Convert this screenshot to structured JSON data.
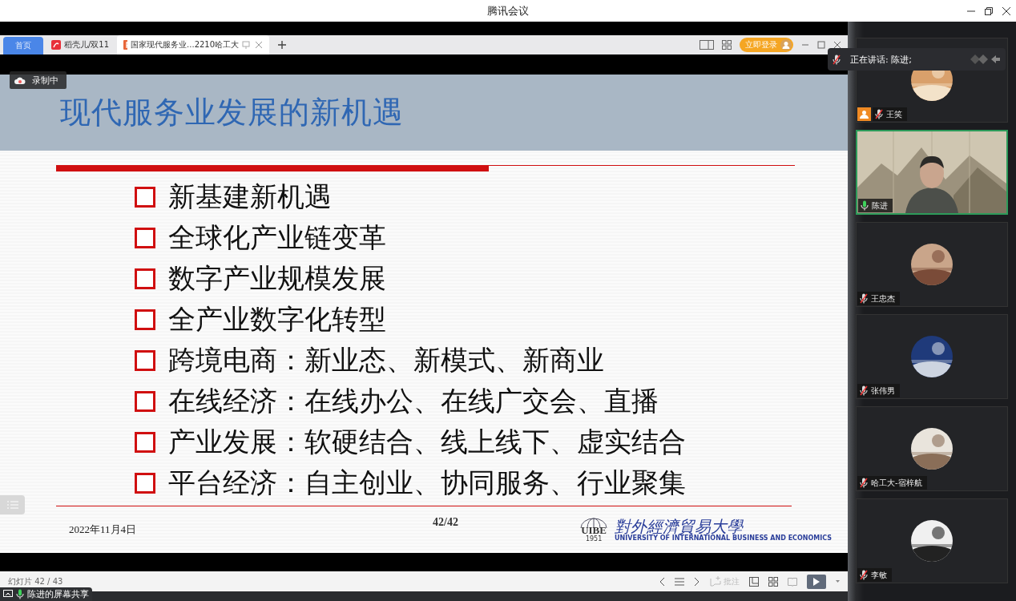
{
  "window": {
    "title": "腾讯会议"
  },
  "recording": {
    "label": "录制中"
  },
  "browser": {
    "tabs": [
      {
        "kind": "home",
        "label": "首页",
        "selected": false
      },
      {
        "kind": "doc",
        "label": "稻壳儿/双11",
        "selected": false
      },
      {
        "kind": "file",
        "label": "国家现代服务业...2210哈工大",
        "selected": true
      }
    ],
    "login_button": "立即登录"
  },
  "slide": {
    "title": "现代服务业发展的新机遇",
    "bullets": [
      "新基建新机遇",
      "全球化产业链变革",
      "数字产业规模发展",
      "全产业数字化转型",
      "跨境电商：新业态、新模式、新商业",
      "在线经济：在线办公、在线广交会、直播",
      "产业发展：软硬结合、线上线下、虚实结合",
      "平台经济：自主创业、协同服务、行业聚集"
    ],
    "date": "2022年11月4日",
    "page": "42/42",
    "logo": {
      "mark": "UIBE",
      "year": "1951",
      "name": "對外經濟貿易大學",
      "english": "UNIVERSITY OF INTERNATIONAL BUSINESS AND ECONOMICS"
    }
  },
  "status_bar": {
    "slide_counter": "幻灯片 42 / 43",
    "annotate": "批注"
  },
  "sharing": {
    "label": "陈进的屏幕共享"
  },
  "speaking": {
    "label": "正在讲话: 陈进;"
  },
  "participants": [
    {
      "name": "王笑",
      "kind": "avatar",
      "muted": true,
      "host": true,
      "selected": false
    },
    {
      "name": "陈进",
      "kind": "video",
      "muted": false,
      "host": false,
      "selected": true
    },
    {
      "name": "王忠杰",
      "kind": "avatar",
      "muted": true,
      "host": false,
      "selected": false
    },
    {
      "name": "张伟男",
      "kind": "avatar",
      "muted": true,
      "host": false,
      "selected": false
    },
    {
      "name": "哈工大-宿梓航",
      "kind": "avatar",
      "muted": true,
      "host": false,
      "selected": false
    },
    {
      "name": "李敏",
      "kind": "avatar",
      "muted": true,
      "host": false,
      "selected": false
    }
  ]
}
